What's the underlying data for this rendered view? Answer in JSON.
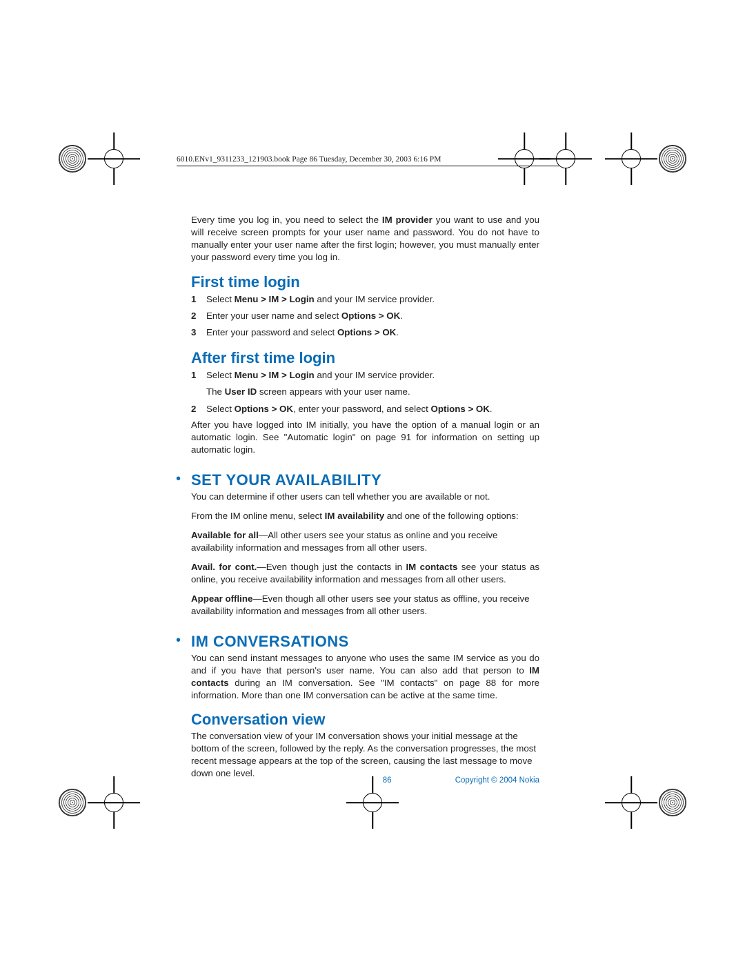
{
  "header": {
    "crop_text": "6010.ENv1_9311233_121903.book  Page 86  Tuesday, December 30, 2003  6:16 PM"
  },
  "intro": {
    "p1_a": "Every time you log in, you need to select the ",
    "p1_b": "IM provider",
    "p1_c": " you want to use and you will receive screen prompts for your user name and password. You do not have to manually enter your user name after the first login; however, you must manually enter your password every time you log in."
  },
  "first_login": {
    "title": "First time login",
    "items": [
      {
        "n": "1",
        "a": "Select ",
        "b": "Menu > IM > Login",
        "c": " and your IM service provider."
      },
      {
        "n": "2",
        "a": "Enter your user name and select ",
        "b": "Options > OK",
        "c": "."
      },
      {
        "n": "3",
        "a": "Enter your password and select ",
        "b": "Options > OK",
        "c": "."
      }
    ]
  },
  "after_login": {
    "title": "After first time login",
    "item1": {
      "n": "1",
      "a": "Select ",
      "b": "Menu > IM > Login",
      "c": " and your IM service provider."
    },
    "sub_a": "The ",
    "sub_b": "User ID",
    "sub_c": " screen appears with your user name.",
    "item2": {
      "n": "2",
      "a": "Select ",
      "b": "Options > OK",
      "c": ", enter your password, and select ",
      "d": "Options > OK",
      "e": "."
    },
    "tail": "After you have logged into IM initially, you have the option of a manual login or an automatic login. See \"Automatic login\" on page 91 for information on setting up automatic login."
  },
  "availability": {
    "title": "SET YOUR AVAILABILITY",
    "p1": "You can determine if other users can tell whether you are available or not.",
    "p2_a": "From the IM online menu, select ",
    "p2_b": "IM availability",
    "p2_c": " and one of the following options:",
    "opt1_a": "Available for all",
    "opt1_b": "—All other users see your status as online and you receive availability information and messages from all other users.",
    "opt2_a": "Avail. for cont.",
    "opt2_b": "—Even though just the contacts in ",
    "opt2_c": "IM contacts",
    "opt2_d": " see your status as online, you receive availability information and messages from all other users.",
    "opt3_a": "Appear offline",
    "opt3_b": "—Even though all other users see your status as offline, you receive availability information and messages from all other users."
  },
  "conversations": {
    "title": "IM CONVERSATIONS",
    "p1_a": "You can send instant messages to anyone who uses the same IM service as you do and if you have that person's user name. You can also add that person to ",
    "p1_b": "IM contacts",
    "p1_c": " during an IM conversation. See \"IM contacts\" on page 88 for more information. More than one IM conversation can be active at the same time.",
    "sub_title": "Conversation view",
    "p2": "The conversation view of your IM conversation shows your initial message at the bottom of the screen, followed by the reply. As the conversation progresses, the most recent message appears at the top of the screen, causing the last message to move down one level."
  },
  "footer": {
    "page": "86",
    "copyright": "Copyright © 2004 Nokia"
  }
}
